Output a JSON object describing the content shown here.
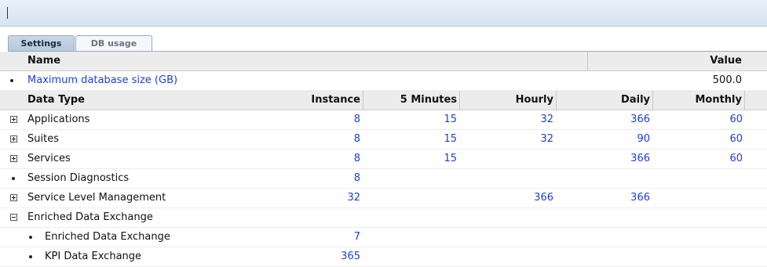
{
  "tabs": [
    {
      "label": "Settings",
      "active": true
    },
    {
      "label": "DB usage",
      "active": false
    }
  ],
  "settings_header": {
    "name": "Name",
    "value": "Value"
  },
  "settings_rows": [
    {
      "name": "Maximum database size (GB)",
      "value": "500.0"
    }
  ],
  "usage_header": {
    "data_type": "Data Type",
    "instance": "Instance",
    "five_minutes": "5 Minutes",
    "hourly": "Hourly",
    "daily": "Daily",
    "monthly": "Monthly"
  },
  "usage_rows": [
    {
      "label": "Applications",
      "icon": "plus",
      "indent": 0,
      "instance": "8",
      "five_minutes": "15",
      "hourly": "32",
      "daily": "366",
      "monthly": "60"
    },
    {
      "label": "Suites",
      "icon": "plus",
      "indent": 0,
      "instance": "8",
      "five_minutes": "15",
      "hourly": "32",
      "daily": "90",
      "monthly": "60"
    },
    {
      "label": "Services",
      "icon": "plus",
      "indent": 0,
      "instance": "8",
      "five_minutes": "15",
      "hourly": "",
      "daily": "366",
      "monthly": "60"
    },
    {
      "label": "Session Diagnostics",
      "icon": "bullet",
      "indent": 0,
      "instance": "8",
      "five_minutes": "",
      "hourly": "",
      "daily": "",
      "monthly": ""
    },
    {
      "label": "Service Level Management",
      "icon": "plus",
      "indent": 0,
      "instance": "32",
      "five_minutes": "",
      "hourly": "366",
      "daily": "366",
      "monthly": ""
    },
    {
      "label": "Enriched Data Exchange",
      "icon": "minus",
      "indent": 0,
      "instance": "",
      "five_minutes": "",
      "hourly": "",
      "daily": "",
      "monthly": ""
    },
    {
      "label": "Enriched Data Exchange",
      "icon": "bullet",
      "indent": 1,
      "instance": "7",
      "five_minutes": "",
      "hourly": "",
      "daily": "",
      "monthly": ""
    },
    {
      "label": "KPI Data Exchange",
      "icon": "bullet",
      "indent": 1,
      "instance": "365",
      "five_minutes": "",
      "hourly": "",
      "daily": "",
      "monthly": ""
    }
  ]
}
